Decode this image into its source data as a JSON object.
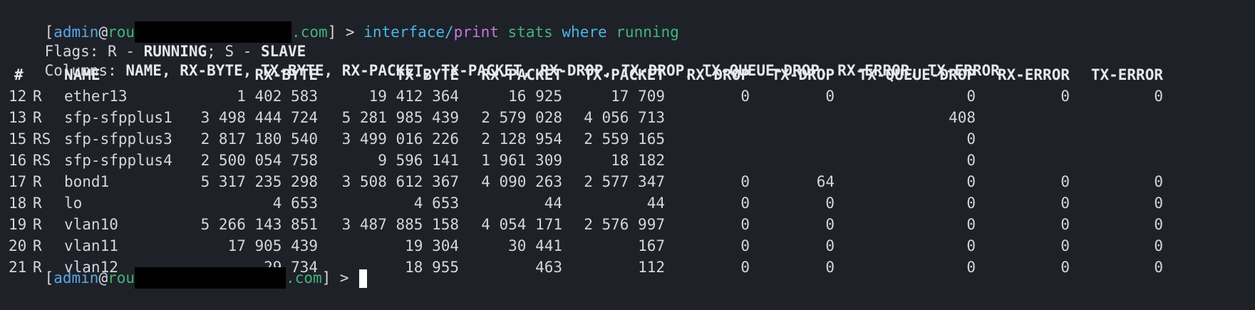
{
  "prompt": {
    "open_bracket": "[",
    "user": "admin",
    "at": "@",
    "host_prefix": "rou",
    "host_suffix": ".com",
    "close": "] >"
  },
  "command": {
    "path_part1": "interface/",
    "path_part2": "print",
    "arg1": "stats",
    "keyword": "where",
    "arg2": "running"
  },
  "flags_line": {
    "prefix": "Flags: R - ",
    "running": "RUNNING",
    "sep": "; S - ",
    "slave": "SLAVE"
  },
  "columns_line": {
    "prefix": "Columns: ",
    "list": "NAME, RX-BYTE, TX-BYTE, RX-PACKET, TX-PACKET, RX-DROP, TX-DROP, TX-QUEUE-DROP, RX-ERROR, TX-ERROR"
  },
  "table": {
    "headers": [
      "#",
      "NAME",
      "RX-BYTE",
      "TX-BYTE",
      "RX-PACKET",
      "TX-PACKET",
      "RX-DROP",
      "TX-DROP",
      "TX-QUEUE-DROP",
      "RX-ERROR",
      "TX-ERROR"
    ],
    "rows": [
      {
        "num": "12",
        "flag": "R",
        "name": "ether13",
        "rx_byte": "1 402 583",
        "tx_byte": "19 412 364",
        "rx_packet": "16 925",
        "tx_packet": "17 709",
        "rx_drop": "0",
        "tx_drop": "0",
        "tx_queue_drop": "0",
        "rx_error": "0",
        "tx_error": "0"
      },
      {
        "num": "13",
        "flag": "R",
        "name": "sfp-sfpplus1",
        "rx_byte": "3 498 444 724",
        "tx_byte": "5 281 985 439",
        "rx_packet": "2 579 028",
        "tx_packet": "4 056 713",
        "rx_drop": "",
        "tx_drop": "",
        "tx_queue_drop": "408",
        "rx_error": "",
        "tx_error": ""
      },
      {
        "num": "15",
        "flag": "RS",
        "name": "sfp-sfpplus3",
        "rx_byte": "2 817 180 540",
        "tx_byte": "3 499 016 226",
        "rx_packet": "2 128 954",
        "tx_packet": "2 559 165",
        "rx_drop": "",
        "tx_drop": "",
        "tx_queue_drop": "0",
        "rx_error": "",
        "tx_error": ""
      },
      {
        "num": "16",
        "flag": "RS",
        "name": "sfp-sfpplus4",
        "rx_byte": "2 500 054 758",
        "tx_byte": "9 596 141",
        "rx_packet": "1 961 309",
        "tx_packet": "18 182",
        "rx_drop": "",
        "tx_drop": "",
        "tx_queue_drop": "0",
        "rx_error": "",
        "tx_error": ""
      },
      {
        "num": "17",
        "flag": "R",
        "name": "bond1",
        "rx_byte": "5 317 235 298",
        "tx_byte": "3 508 612 367",
        "rx_packet": "4 090 263",
        "tx_packet": "2 577 347",
        "rx_drop": "0",
        "tx_drop": "64",
        "tx_queue_drop": "0",
        "rx_error": "0",
        "tx_error": "0"
      },
      {
        "num": "18",
        "flag": "R",
        "name": "lo",
        "rx_byte": "4 653",
        "tx_byte": "4 653",
        "rx_packet": "44",
        "tx_packet": "44",
        "rx_drop": "0",
        "tx_drop": "0",
        "tx_queue_drop": "0",
        "rx_error": "0",
        "tx_error": "0"
      },
      {
        "num": "19",
        "flag": "R",
        "name": "vlan10",
        "rx_byte": "5 266 143 851",
        "tx_byte": "3 487 885 158",
        "rx_packet": "4 054 171",
        "tx_packet": "2 576 997",
        "rx_drop": "0",
        "tx_drop": "0",
        "tx_queue_drop": "0",
        "rx_error": "0",
        "tx_error": "0"
      },
      {
        "num": "20",
        "flag": "R",
        "name": "vlan11",
        "rx_byte": "17 905 439",
        "tx_byte": "19 304",
        "rx_packet": "30 441",
        "tx_packet": "167",
        "rx_drop": "0",
        "tx_drop": "0",
        "tx_queue_drop": "0",
        "rx_error": "0",
        "tx_error": "0"
      },
      {
        "num": "21",
        "flag": "R",
        "name": "vlan12",
        "rx_byte": "29 734",
        "tx_byte": "18 955",
        "rx_packet": "463",
        "tx_packet": "112",
        "rx_drop": "0",
        "tx_drop": "0",
        "tx_queue_drop": "0",
        "rx_error": "0",
        "tx_error": "0"
      }
    ]
  },
  "colors": {
    "background": "#1e2128",
    "text": "#d4d7dd",
    "user": "#5aa7e6",
    "host": "#3fb67a",
    "command_path": "#49b6e6",
    "command_verb": "#c678dd",
    "redaction": "#000000"
  },
  "icons": {
    "cursor": "block-cursor-icon",
    "redaction": "redaction-block"
  }
}
